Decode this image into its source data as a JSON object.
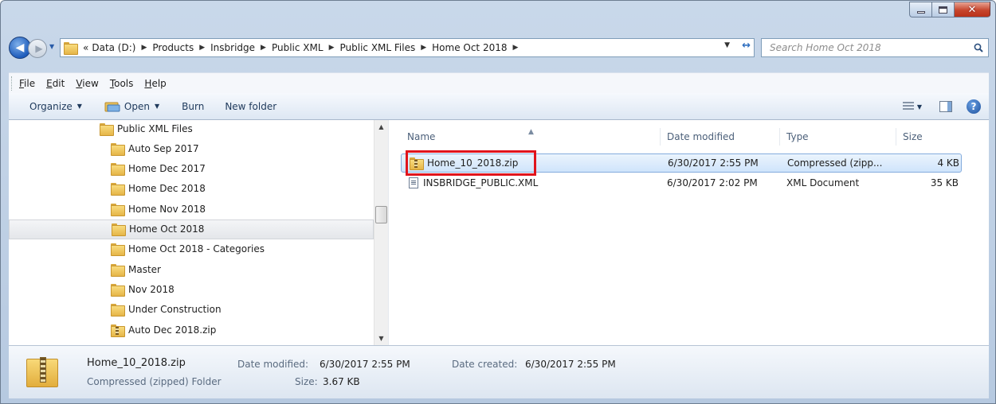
{
  "address": {
    "overflow": "«",
    "crumbs": [
      "Data (D:)",
      "Products",
      "Insbridge",
      "Public XML",
      "Public XML Files",
      "Home Oct 2018"
    ]
  },
  "search": {
    "placeholder": "Search Home Oct 2018"
  },
  "menu": {
    "items": [
      "File",
      "Edit",
      "View",
      "Tools",
      "Help"
    ]
  },
  "toolbar": {
    "organize": "Organize",
    "open": "Open",
    "burn": "Burn",
    "new_folder": "New folder"
  },
  "tree": {
    "items": [
      {
        "label": "Public XML Files",
        "icon": "folder-icon",
        "indent": 1
      },
      {
        "label": "Auto Sep 2017",
        "icon": "folder-icon",
        "indent": 2
      },
      {
        "label": "Home Dec 2017",
        "icon": "folder-icon",
        "indent": 2
      },
      {
        "label": "Home Dec 2018",
        "icon": "folder-icon",
        "indent": 2
      },
      {
        "label": "Home Nov 2018",
        "icon": "folder-icon",
        "indent": 2
      },
      {
        "label": "Home Oct 2018",
        "icon": "folder-icon",
        "indent": 2,
        "selected": true
      },
      {
        "label": "Home Oct 2018 - Categories",
        "icon": "folder-icon",
        "indent": 2
      },
      {
        "label": "Master",
        "icon": "folder-icon",
        "indent": 2
      },
      {
        "label": "Nov 2018",
        "icon": "folder-icon",
        "indent": 2
      },
      {
        "label": "Under Construction",
        "icon": "folder-icon",
        "indent": 2
      },
      {
        "label": "Auto Dec 2018.zip",
        "icon": "zip-folder-icon",
        "indent": 2
      }
    ]
  },
  "columns": {
    "name": "Name",
    "date": "Date modified",
    "type": "Type",
    "size": "Size"
  },
  "files": [
    {
      "name": "Home_10_2018.zip",
      "date": "6/30/2017 2:55 PM",
      "type": "Compressed (zipp...",
      "size": "4 KB",
      "icon": "zip-folder-icon",
      "selected": true
    },
    {
      "name": "INSBRIDGE_PUBLIC.XML",
      "date": "6/30/2017 2:02 PM",
      "type": "XML Document",
      "size": "35 KB",
      "icon": "xml-document-icon"
    }
  ],
  "details": {
    "name": "Home_10_2018.zip",
    "type": "Compressed (zipped) Folder",
    "modified_label": "Date modified:",
    "modified_value": "6/30/2017 2:55 PM",
    "size_label": "Size:",
    "size_value": "3.67 KB",
    "created_label": "Date created:",
    "created_value": "6/30/2017 2:55 PM"
  },
  "colors": {
    "highlight": "#e0141c",
    "selection": "#cfe4fb"
  }
}
